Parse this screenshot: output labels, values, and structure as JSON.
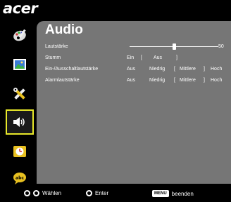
{
  "brand": {
    "logo_text": "acer"
  },
  "sidebar": {
    "items": [
      {
        "name": "color-palette",
        "selected": false
      },
      {
        "name": "image",
        "selected": false
      },
      {
        "name": "settings-tools",
        "selected": false
      },
      {
        "name": "audio",
        "selected": true
      },
      {
        "name": "timer",
        "selected": false
      },
      {
        "name": "language",
        "selected": false
      }
    ]
  },
  "panel": {
    "title": "Audio",
    "volume": {
      "label": "Lautstärke",
      "value": "50",
      "level": 0.5
    },
    "mute": {
      "label": "Stumm",
      "on": "Ein",
      "open_bracket": "[",
      "off": "Aus",
      "close_bracket": "]"
    },
    "power_volume": {
      "label": "Ein-/Ausschaltlautstärke",
      "opt1": "Aus",
      "opt2": "Niedrig",
      "open_bracket": "[",
      "opt3": "Mittlere",
      "close_bracket": "]",
      "opt4": "Hoch"
    },
    "alarm_volume": {
      "label": "Alarmlautstärke",
      "opt1": "Aus",
      "opt2": "Niedrig",
      "open_bracket": "[",
      "opt3": "Mittlere",
      "close_bracket": "]",
      "opt4": "Hoch"
    }
  },
  "footer": {
    "select_label": "Wählen",
    "enter_label": "Enter",
    "menu_key": "MENU",
    "exit_label": "beenden"
  },
  "colors": {
    "panel_bg": "#767676",
    "selected_border": "#e8e82a",
    "background": "#000000"
  }
}
